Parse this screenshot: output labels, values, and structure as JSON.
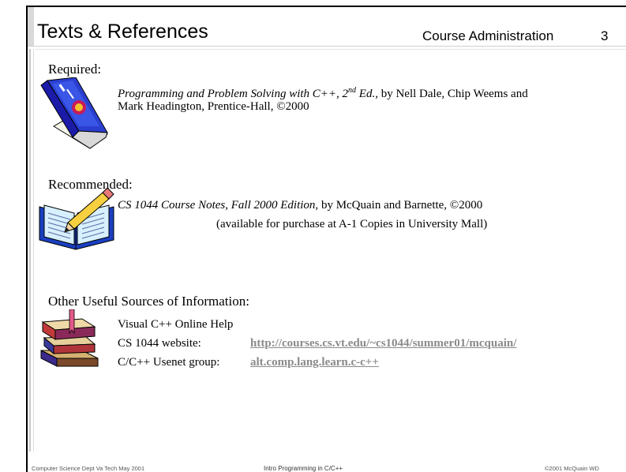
{
  "slide": {
    "title": "Texts & References",
    "section": "Course Administration",
    "page_number": "3"
  },
  "required": {
    "heading": "Required:",
    "book_title": "Programming and Problem Solving with C++, 2",
    "edition_sup": "nd",
    "edition_rest": " Ed.",
    "authors_line1": ", by Nell Dale, Chip Weems and",
    "authors_line2": "Mark Headington, Prentice-Hall, ©2000"
  },
  "recommended": {
    "heading": "Recommended:",
    "notes_title": "CS 1044 Course Notes, Fall 2000 Edition,",
    "notes_rest": " by McQuain and Barnette, ©2000",
    "availability": "(available for purchase at A-1 Copies in University Mall)"
  },
  "other": {
    "heading": "Other Useful Sources of Information:",
    "item1": "Visual C++ Online Help",
    "website_label": "CS 1044 website:",
    "website_url": "http://courses.cs.vt.edu/~cs1044/summer01/mcquain/",
    "usenet_label": "C/C++ Usenet group:",
    "usenet_group": "alt.comp.lang.learn.c-c++"
  },
  "footer": {
    "left": "Computer Science Dept Va Tech May 2001",
    "center": "Intro Programming in C/C++",
    "right": "©2001  McQuain WD"
  },
  "icons": [
    "book-icon",
    "open-book-pencil-icon",
    "book-stack-icon"
  ]
}
